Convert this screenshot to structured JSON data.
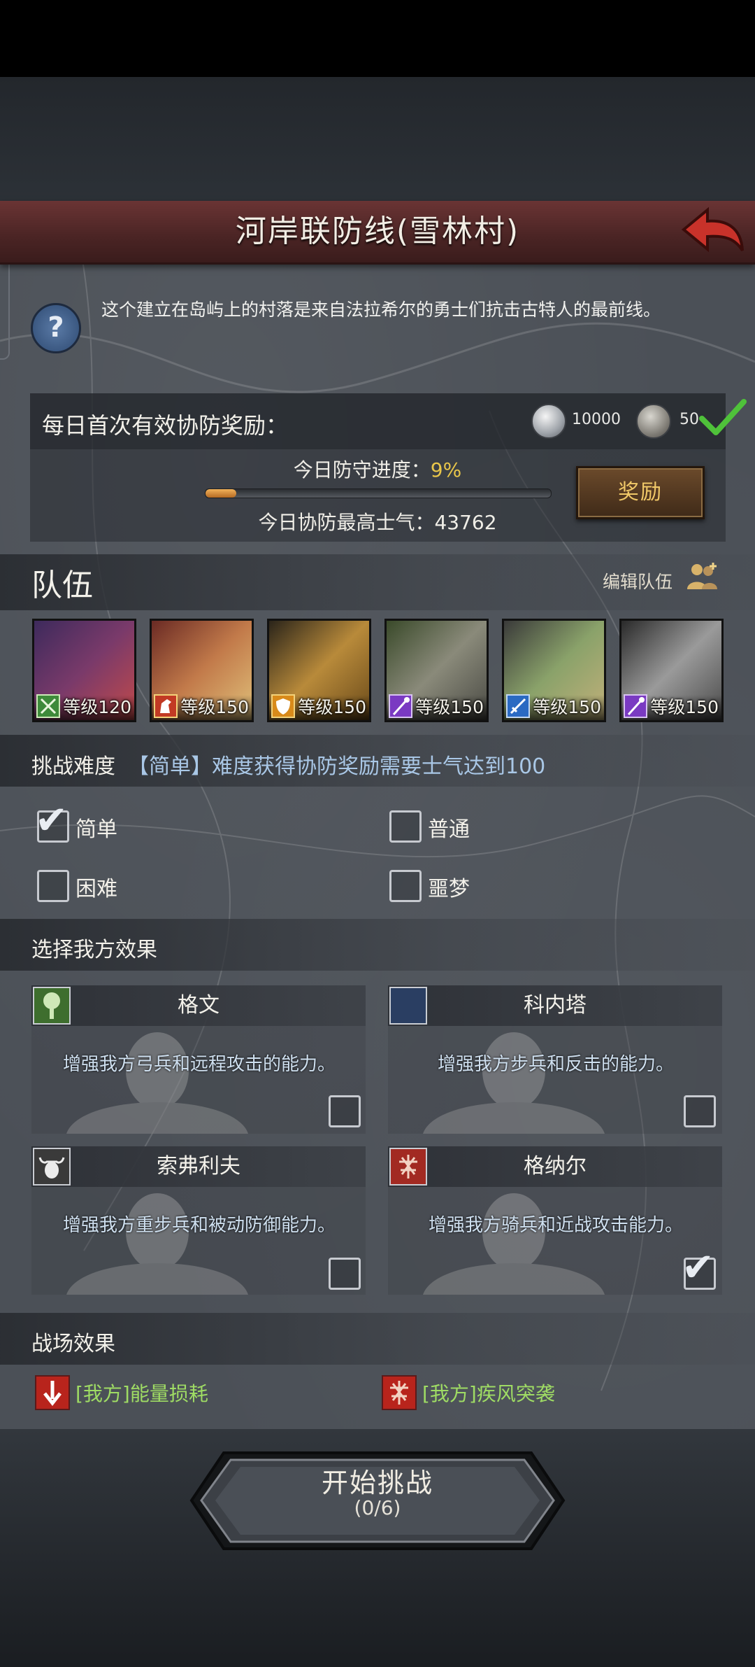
{
  "colors": {
    "title_bar": "#5a2c2c",
    "panel": "#4b5057",
    "accent_gold": "#e9c64a",
    "field_green": "#9fdc64",
    "rule_blue": "#a9c7e6"
  },
  "header": {
    "title": "河岸联防线(雪林村)",
    "back_icon": "back-arrow-icon"
  },
  "description": "这个建立在岛屿上的村落是来自法拉希尔的勇士们抗击古特人的最前线。",
  "daily_reward": {
    "label": "每日首次有效协防奖励：",
    "coin1_amount": "10000",
    "coin2_amount": "50",
    "progress_label": "今日防守进度：",
    "progress_value": "9%",
    "progress_fraction": 0.09,
    "morale_label": "今日协防最高士气：",
    "morale_value": "43762",
    "reward_button": "奖励"
  },
  "team": {
    "title": "队伍",
    "edit_label": "编辑队伍",
    "heroes": [
      {
        "level": "等级120",
        "class_icon": "green-class-icon"
      },
      {
        "level": "等级150",
        "class_icon": "cavalry-class-icon"
      },
      {
        "level": "等级150",
        "class_icon": "shield-class-icon"
      },
      {
        "level": "等级150",
        "class_icon": "staff-class-icon"
      },
      {
        "level": "等级150",
        "class_icon": "sword-class-icon"
      },
      {
        "level": "等级150",
        "class_icon": "staff-class-icon"
      }
    ]
  },
  "difficulty": {
    "label": "挑战难度",
    "rule": "【简单】难度获得协防奖励需要士气达到100",
    "options": [
      {
        "label": "简单",
        "checked": true
      },
      {
        "label": "普通",
        "checked": false
      },
      {
        "label": "困难",
        "checked": false
      },
      {
        "label": "噩梦",
        "checked": false
      }
    ]
  },
  "our_effects": {
    "label": "选择我方效果",
    "cards": [
      {
        "name": "格文",
        "desc": "增强我方弓兵和远程攻击的能力。",
        "checked": false,
        "icon": "tree-icon"
      },
      {
        "name": "科内塔",
        "desc": "增强我方步兵和反击的能力。",
        "checked": false,
        "icon": "crescent-icon"
      },
      {
        "name": "索弗利夫",
        "desc": "增强我方重步兵和被动防御能力。",
        "checked": false,
        "icon": "bull-skull-icon"
      },
      {
        "name": "格纳尔",
        "desc": "增强我方骑兵和近战攻击能力。",
        "checked": true,
        "icon": "rune-icon"
      }
    ]
  },
  "field_effects": {
    "label": "战场效果",
    "items": [
      {
        "label": "[我方]能量损耗",
        "icon": "down-arrow-icon"
      },
      {
        "label": "[我方]疾风突袭",
        "icon": "rune-icon"
      }
    ]
  },
  "start": {
    "label": "开始挑战",
    "count": "(0/6)"
  }
}
